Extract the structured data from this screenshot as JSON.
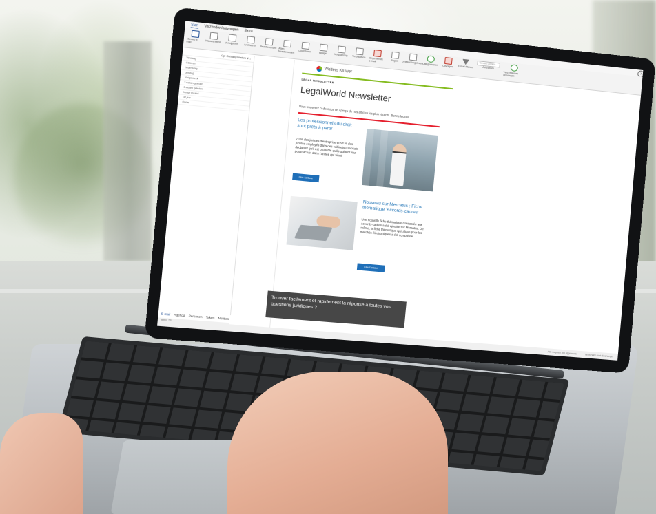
{
  "ribbon": {
    "tabs": [
      "Start",
      "Verzenden/ontvangen",
      "Extra"
    ],
    "active_tab": "Start",
    "buttons": [
      {
        "label": "Nieuwe e-mail",
        "icon": "envelope-icon"
      },
      {
        "label": "Nieuwe items",
        "icon": "new-items-icon"
      },
      {
        "label": "Verwijderen",
        "icon": "trash-icon"
      },
      {
        "label": "Archiveren",
        "icon": "archive-icon"
      },
      {
        "label": "Beantwoorden",
        "icon": "reply-icon"
      },
      {
        "label": "Allen beantwoorden",
        "icon": "reply-all-icon"
      },
      {
        "label": "Doorsturen",
        "icon": "forward-icon"
      },
      {
        "label": "Bijlage",
        "icon": "attachment-icon"
      },
      {
        "label": "Vergadering",
        "icon": "meeting-icon"
      },
      {
        "label": "Verplaatsen",
        "icon": "move-icon"
      },
      {
        "label": "Ongewenste e-mail",
        "icon": "junk-icon"
      },
      {
        "label": "Regels",
        "icon": "rules-icon"
      },
      {
        "label": "Gelezen/ongelezen",
        "icon": "read-icon"
      },
      {
        "label": "Categoriseren",
        "icon": "categorize-icon"
      },
      {
        "label": "Opvolgen",
        "icon": "flag-icon"
      },
      {
        "label": "E-mail filteren",
        "icon": "filter-icon"
      },
      {
        "label": "Adresboek",
        "icon": "address-book-icon"
      },
      {
        "label": "Verzenden en ontvangen",
        "icon": "sync-icon"
      }
    ],
    "contact_search_placeholder": "Contact zoeken"
  },
  "sidebar": {
    "header": "Op: Ontvangstdatum ∨ ↓",
    "folders": [
      "Vandaag",
      "Gisteren",
      "Woensdag",
      "dinsdag",
      "Vorige week",
      "2 weken geleden",
      "3 weken geleden",
      "Vorige maand",
      "Dit jaar",
      "Ouder"
    ],
    "nav": [
      "E-mail",
      "Agenda",
      "Personen",
      "Taken",
      "Notities"
    ],
    "status": "Items: 751"
  },
  "status_bar": {
    "left": "Alle mappen zijn bijgewerkt.",
    "right": "Verbonden met: Exchange"
  },
  "newsletter": {
    "brand": "Wolters Kluwer",
    "kicker": "LEGAL NEWSLETTER",
    "title": "LegalWorld Newsletter",
    "intro": "Vous trouverez ci-dessous un aperçu de nos articles les plus récents. Bonne lecture.",
    "article1": {
      "title": "Les professionnels du droit sont prêts à partir",
      "body": "70 % des juristes d'entreprise et 58 % des juristes employés dans des cabinets d'avocats déclarent qu'il est probable qu'ils quittent leur poste actuel dans l'année qui vient.",
      "button": "Lire l'article"
    },
    "article2": {
      "title": "Nouveau sur Mercatus : Fiche thématique 'Accords-cadres'",
      "body": "Une nouvelle fiche thématique consacrée aux accords-cadres a été ajoutée sur Mercatus. De même, la fiche thématique spécifique pour les marchés électroniques a été complétée.",
      "button": "Lire l'article"
    },
    "cta": "Trouver facilement et rapidement la réponse à toutes vos questions juridiques ?"
  },
  "colors": {
    "wk_green": "#85bc20",
    "wk_red": "#e5202e",
    "link_blue": "#2a7ab9",
    "button_blue": "#1f6fb8",
    "cta_gray": "#474747"
  }
}
